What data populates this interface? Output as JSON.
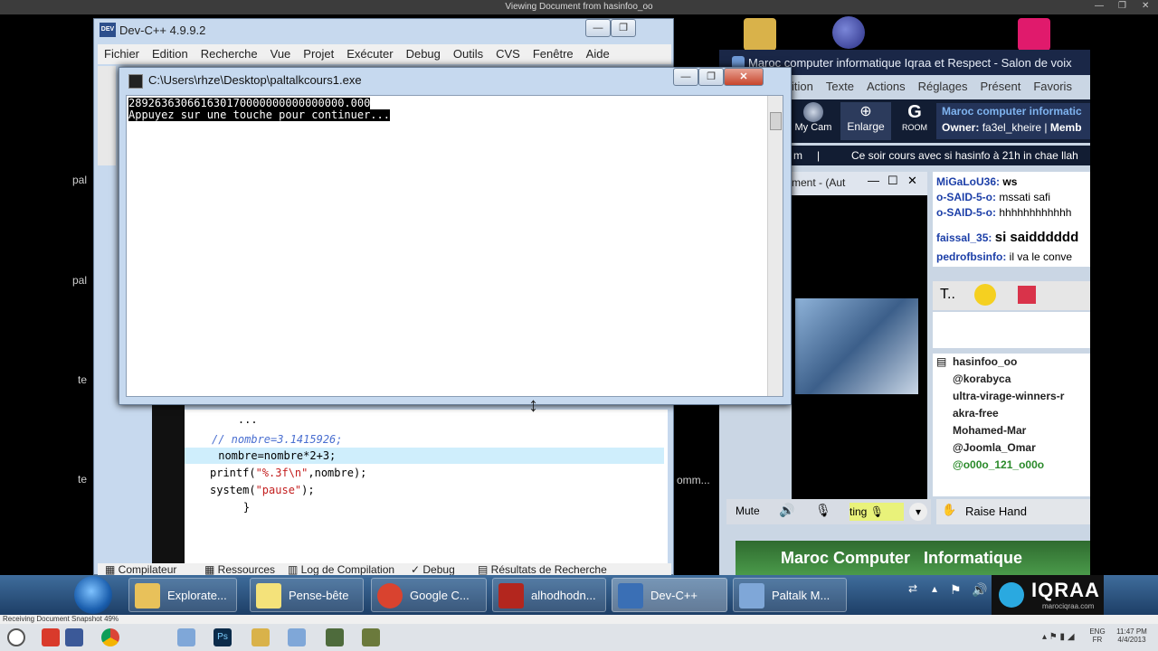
{
  "outer": {
    "title": "Viewing Document from hasinfoo_oo",
    "minimize": "—",
    "restore": "❐",
    "close": "✕"
  },
  "desktop": {
    "labels": [
      "pal",
      "pal",
      "te",
      "te"
    ],
    "partial_text": "omm..."
  },
  "devcpp": {
    "title": "Dev-C++ 4.9.9.2",
    "app_icon": "DEV",
    "menu": [
      "Fichier",
      "Edition",
      "Recherche",
      "Vue",
      "Projet",
      "Exécuter",
      "Debug",
      "Outils",
      "CVS",
      "Fenêtre",
      "Aide"
    ],
    "code": {
      "partial_top": "    ...",
      "comment": "// nombre=3.1415926;",
      "line_assign": " nombre=nombre*2+3;",
      "printf_pre": "printf(",
      "printf_str": "\"%.3f\\n\"",
      "printf_post": ",nombre);",
      "system_pre": "system(",
      "system_str": "\"pause\"",
      "system_post": ");",
      "closing": "    }"
    },
    "bottom_tabs": [
      "Compilateur",
      "Ressources",
      "Log de Compilation",
      "Debug",
      "Résultats de Recherche"
    ]
  },
  "console": {
    "title": "C:\\Users\\rhze\\Desktop\\paltalkcours1.exe",
    "lines": [
      "289263630661630170000000000000000.000",
      "Appuyez sur une touche pour continuer..."
    ]
  },
  "paltalk": {
    "title": "Maroc computer informatique Iqraa et Respect - Salon de voix",
    "menu": [
      "ition",
      "Texte",
      "Actions",
      "Réglages",
      "Présent",
      "Favoris"
    ],
    "toolbar": {
      "mycam": "My Cam",
      "enlarge": "Enlarge",
      "room": "ROOM",
      "room_letter": "G"
    },
    "room_name": "Maroc computer informatic",
    "owner_label": "Owner:",
    "owner_name": "fa3el_kheire",
    "member_label": "Memb",
    "ticker": [
      "m",
      "Ce soir cours avec si hasinfo à 21h in chae llah"
    ],
    "cam_window": {
      "title": "ment - (Aut"
    },
    "chat": [
      {
        "user": "MiGaLoU36:",
        "msg": "ws"
      },
      {
        "user": "o-SAID-5-o:",
        "msg": "mssati safi"
      },
      {
        "user": "o-SAID-5-o:",
        "msg": "hhhhhhhhhhhh"
      },
      {
        "user": "faissal_35:",
        "msg": "si saidddddd"
      },
      {
        "user": "pedrofbsinfo:",
        "msg": "il va le conve"
      }
    ],
    "text_tool": "T",
    "users": [
      "hasinfoo_oo",
      "@korabyca",
      "ultra-virage-winners-r",
      "akra-free",
      "Mohamed-Mar",
      "@Joomla_Omar",
      "@o00o_121_o00o"
    ],
    "bottom": {
      "mute": "Mute",
      "talking": "ting",
      "raise_hand": "Raise Hand"
    },
    "banner": "Maroc Computer   Informatique"
  },
  "taskbar": {
    "buttons": [
      {
        "label": "Explorate...",
        "color": "#e8c15a"
      },
      {
        "label": "Pense-bête",
        "color": "#f4e27a"
      },
      {
        "label": "Google C...",
        "color": "#d9432f"
      },
      {
        "label": "alhodhodn...",
        "color": "#b3261e"
      },
      {
        "label": "Dev-C++",
        "color": "#3a6fb5"
      },
      {
        "label": "Paltalk M...",
        "color": "#7fa7d8"
      }
    ],
    "iqraa_logo": "IQRAA",
    "iqraa_url": "marociqraa.com",
    "lang": "ENG",
    "region": "FR",
    "time": "11:47 PM",
    "date": "4/4/2013"
  },
  "status": {
    "text": "Receiving Document Snapshot 49%",
    "progress": 49
  }
}
